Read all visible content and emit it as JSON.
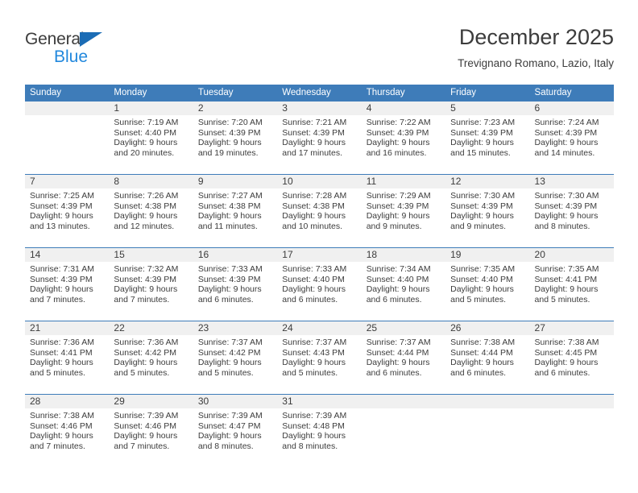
{
  "brand": {
    "name_top": "General",
    "name_bottom": "Blue",
    "triangle_color": "#1b6cb5",
    "text_color": "#3c3c3c",
    "blue_text_color": "#2288dd"
  },
  "header": {
    "title": "December 2025",
    "subtitle": "Trevignano Romano, Lazio, Italy"
  },
  "colors": {
    "header_blue": "#3e7cb9",
    "daynum_band": "#f0f0f0",
    "text": "#3c3c3c"
  },
  "calendar": {
    "weekday_headers": [
      "Sunday",
      "Monday",
      "Tuesday",
      "Wednesday",
      "Thursday",
      "Friday",
      "Saturday"
    ],
    "weeks": [
      [
        {
          "day": "",
          "sunrise": "",
          "sunset": "",
          "daylight_line1": "",
          "daylight_line2": ""
        },
        {
          "day": "1",
          "sunrise": "Sunrise: 7:19 AM",
          "sunset": "Sunset: 4:40 PM",
          "daylight_line1": "Daylight: 9 hours",
          "daylight_line2": "and 20 minutes."
        },
        {
          "day": "2",
          "sunrise": "Sunrise: 7:20 AM",
          "sunset": "Sunset: 4:39 PM",
          "daylight_line1": "Daylight: 9 hours",
          "daylight_line2": "and 19 minutes."
        },
        {
          "day": "3",
          "sunrise": "Sunrise: 7:21 AM",
          "sunset": "Sunset: 4:39 PM",
          "daylight_line1": "Daylight: 9 hours",
          "daylight_line2": "and 17 minutes."
        },
        {
          "day": "4",
          "sunrise": "Sunrise: 7:22 AM",
          "sunset": "Sunset: 4:39 PM",
          "daylight_line1": "Daylight: 9 hours",
          "daylight_line2": "and 16 minutes."
        },
        {
          "day": "5",
          "sunrise": "Sunrise: 7:23 AM",
          "sunset": "Sunset: 4:39 PM",
          "daylight_line1": "Daylight: 9 hours",
          "daylight_line2": "and 15 minutes."
        },
        {
          "day": "6",
          "sunrise": "Sunrise: 7:24 AM",
          "sunset": "Sunset: 4:39 PM",
          "daylight_line1": "Daylight: 9 hours",
          "daylight_line2": "and 14 minutes."
        }
      ],
      [
        {
          "day": "7",
          "sunrise": "Sunrise: 7:25 AM",
          "sunset": "Sunset: 4:39 PM",
          "daylight_line1": "Daylight: 9 hours",
          "daylight_line2": "and 13 minutes."
        },
        {
          "day": "8",
          "sunrise": "Sunrise: 7:26 AM",
          "sunset": "Sunset: 4:38 PM",
          "daylight_line1": "Daylight: 9 hours",
          "daylight_line2": "and 12 minutes."
        },
        {
          "day": "9",
          "sunrise": "Sunrise: 7:27 AM",
          "sunset": "Sunset: 4:38 PM",
          "daylight_line1": "Daylight: 9 hours",
          "daylight_line2": "and 11 minutes."
        },
        {
          "day": "10",
          "sunrise": "Sunrise: 7:28 AM",
          "sunset": "Sunset: 4:38 PM",
          "daylight_line1": "Daylight: 9 hours",
          "daylight_line2": "and 10 minutes."
        },
        {
          "day": "11",
          "sunrise": "Sunrise: 7:29 AM",
          "sunset": "Sunset: 4:39 PM",
          "daylight_line1": "Daylight: 9 hours",
          "daylight_line2": "and 9 minutes."
        },
        {
          "day": "12",
          "sunrise": "Sunrise: 7:30 AM",
          "sunset": "Sunset: 4:39 PM",
          "daylight_line1": "Daylight: 9 hours",
          "daylight_line2": "and 9 minutes."
        },
        {
          "day": "13",
          "sunrise": "Sunrise: 7:30 AM",
          "sunset": "Sunset: 4:39 PM",
          "daylight_line1": "Daylight: 9 hours",
          "daylight_line2": "and 8 minutes."
        }
      ],
      [
        {
          "day": "14",
          "sunrise": "Sunrise: 7:31 AM",
          "sunset": "Sunset: 4:39 PM",
          "daylight_line1": "Daylight: 9 hours",
          "daylight_line2": "and 7 minutes."
        },
        {
          "day": "15",
          "sunrise": "Sunrise: 7:32 AM",
          "sunset": "Sunset: 4:39 PM",
          "daylight_line1": "Daylight: 9 hours",
          "daylight_line2": "and 7 minutes."
        },
        {
          "day": "16",
          "sunrise": "Sunrise: 7:33 AM",
          "sunset": "Sunset: 4:39 PM",
          "daylight_line1": "Daylight: 9 hours",
          "daylight_line2": "and 6 minutes."
        },
        {
          "day": "17",
          "sunrise": "Sunrise: 7:33 AM",
          "sunset": "Sunset: 4:40 PM",
          "daylight_line1": "Daylight: 9 hours",
          "daylight_line2": "and 6 minutes."
        },
        {
          "day": "18",
          "sunrise": "Sunrise: 7:34 AM",
          "sunset": "Sunset: 4:40 PM",
          "daylight_line1": "Daylight: 9 hours",
          "daylight_line2": "and 6 minutes."
        },
        {
          "day": "19",
          "sunrise": "Sunrise: 7:35 AM",
          "sunset": "Sunset: 4:40 PM",
          "daylight_line1": "Daylight: 9 hours",
          "daylight_line2": "and 5 minutes."
        },
        {
          "day": "20",
          "sunrise": "Sunrise: 7:35 AM",
          "sunset": "Sunset: 4:41 PM",
          "daylight_line1": "Daylight: 9 hours",
          "daylight_line2": "and 5 minutes."
        }
      ],
      [
        {
          "day": "21",
          "sunrise": "Sunrise: 7:36 AM",
          "sunset": "Sunset: 4:41 PM",
          "daylight_line1": "Daylight: 9 hours",
          "daylight_line2": "and 5 minutes."
        },
        {
          "day": "22",
          "sunrise": "Sunrise: 7:36 AM",
          "sunset": "Sunset: 4:42 PM",
          "daylight_line1": "Daylight: 9 hours",
          "daylight_line2": "and 5 minutes."
        },
        {
          "day": "23",
          "sunrise": "Sunrise: 7:37 AM",
          "sunset": "Sunset: 4:42 PM",
          "daylight_line1": "Daylight: 9 hours",
          "daylight_line2": "and 5 minutes."
        },
        {
          "day": "24",
          "sunrise": "Sunrise: 7:37 AM",
          "sunset": "Sunset: 4:43 PM",
          "daylight_line1": "Daylight: 9 hours",
          "daylight_line2": "and 5 minutes."
        },
        {
          "day": "25",
          "sunrise": "Sunrise: 7:37 AM",
          "sunset": "Sunset: 4:44 PM",
          "daylight_line1": "Daylight: 9 hours",
          "daylight_line2": "and 6 minutes."
        },
        {
          "day": "26",
          "sunrise": "Sunrise: 7:38 AM",
          "sunset": "Sunset: 4:44 PM",
          "daylight_line1": "Daylight: 9 hours",
          "daylight_line2": "and 6 minutes."
        },
        {
          "day": "27",
          "sunrise": "Sunrise: 7:38 AM",
          "sunset": "Sunset: 4:45 PM",
          "daylight_line1": "Daylight: 9 hours",
          "daylight_line2": "and 6 minutes."
        }
      ],
      [
        {
          "day": "28",
          "sunrise": "Sunrise: 7:38 AM",
          "sunset": "Sunset: 4:46 PM",
          "daylight_line1": "Daylight: 9 hours",
          "daylight_line2": "and 7 minutes."
        },
        {
          "day": "29",
          "sunrise": "Sunrise: 7:39 AM",
          "sunset": "Sunset: 4:46 PM",
          "daylight_line1": "Daylight: 9 hours",
          "daylight_line2": "and 7 minutes."
        },
        {
          "day": "30",
          "sunrise": "Sunrise: 7:39 AM",
          "sunset": "Sunset: 4:47 PM",
          "daylight_line1": "Daylight: 9 hours",
          "daylight_line2": "and 8 minutes."
        },
        {
          "day": "31",
          "sunrise": "Sunrise: 7:39 AM",
          "sunset": "Sunset: 4:48 PM",
          "daylight_line1": "Daylight: 9 hours",
          "daylight_line2": "and 8 minutes."
        },
        {
          "day": "",
          "sunrise": "",
          "sunset": "",
          "daylight_line1": "",
          "daylight_line2": ""
        },
        {
          "day": "",
          "sunrise": "",
          "sunset": "",
          "daylight_line1": "",
          "daylight_line2": ""
        },
        {
          "day": "",
          "sunrise": "",
          "sunset": "",
          "daylight_line1": "",
          "daylight_line2": ""
        }
      ]
    ]
  }
}
